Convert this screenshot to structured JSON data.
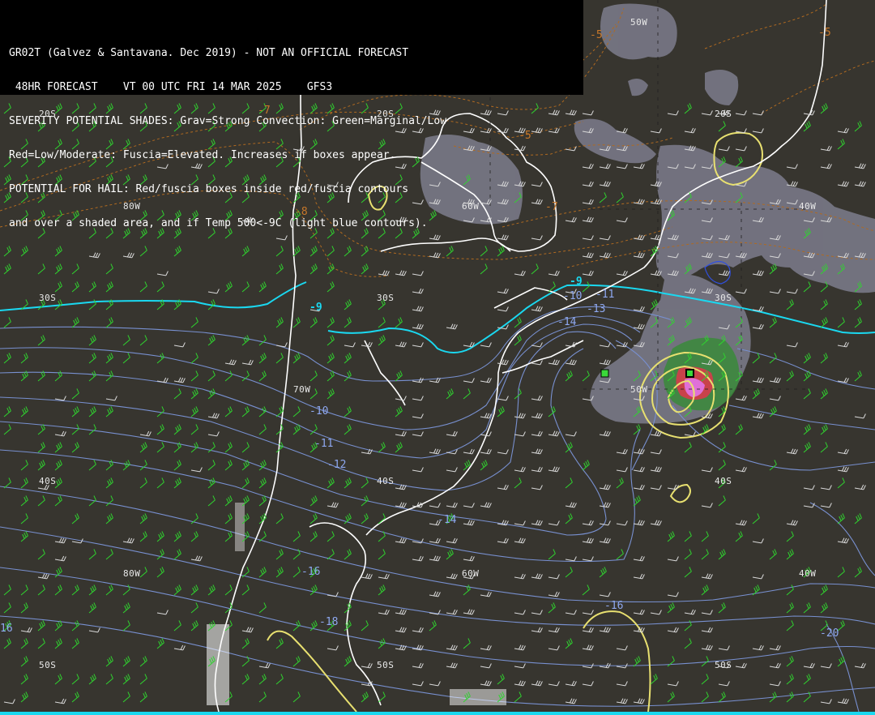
{
  "header": {
    "lines": [
      "GR02T (Galvez & Santavana. Dec 2019) - NOT AN OFFICIAL FORECAST",
      " 48HR FORECAST    VT 00 UTC FRI 14 MAR 2025    GFS3",
      "SEVERITY POTENTIAL SHADES: Grav=Strong Convection: Green=Marginal/Low",
      "Red=Low/Moderate: Fuscia=Elevated. Increases if boxes appear.",
      "POTENTIAL FOR HAIL: Red/fuscia boxes inside red/fuscia contours",
      "and over a shaded area, and if Temp 500<-9C (light blue contours)."
    ]
  },
  "grid_labels": {
    "lat_20s": "20S",
    "lat_30s": "30S",
    "lat_40s": "40S",
    "lat_50s": "50S",
    "lon_80w": "80W",
    "lon_70w": "70W",
    "lon_60w": "60W",
    "lon_50w": "50W",
    "lon_40w": "40W"
  },
  "contour_labels": {
    "orange_m5": "-5",
    "orange_m7": "-7",
    "orange_m8": "-8",
    "cyan_m9": "-9",
    "blue_m10": "-10",
    "blue_m11": "-11",
    "blue_m12": "-12",
    "blue_m13": "-13",
    "blue_m14": "-14",
    "blue_m16": "-16",
    "blue_m18": "-18",
    "blue_m20": "-20",
    "blue_16": "16"
  },
  "colors": {
    "background": "#37352f",
    "gray_shade": "#7a7a88",
    "green_shade": "#3c8a3c",
    "red_shade": "#c8424a",
    "fuscia_shade": "#e070d8",
    "yellow_contour": "#e8e070",
    "cyan_contour": "#1ad8f0",
    "blue_contour": "#7890d0",
    "orange_contour": "#b06a20",
    "coastline": "#ffffff",
    "wind_green": "#2fd42f",
    "wind_white": "#d8d8d8"
  }
}
